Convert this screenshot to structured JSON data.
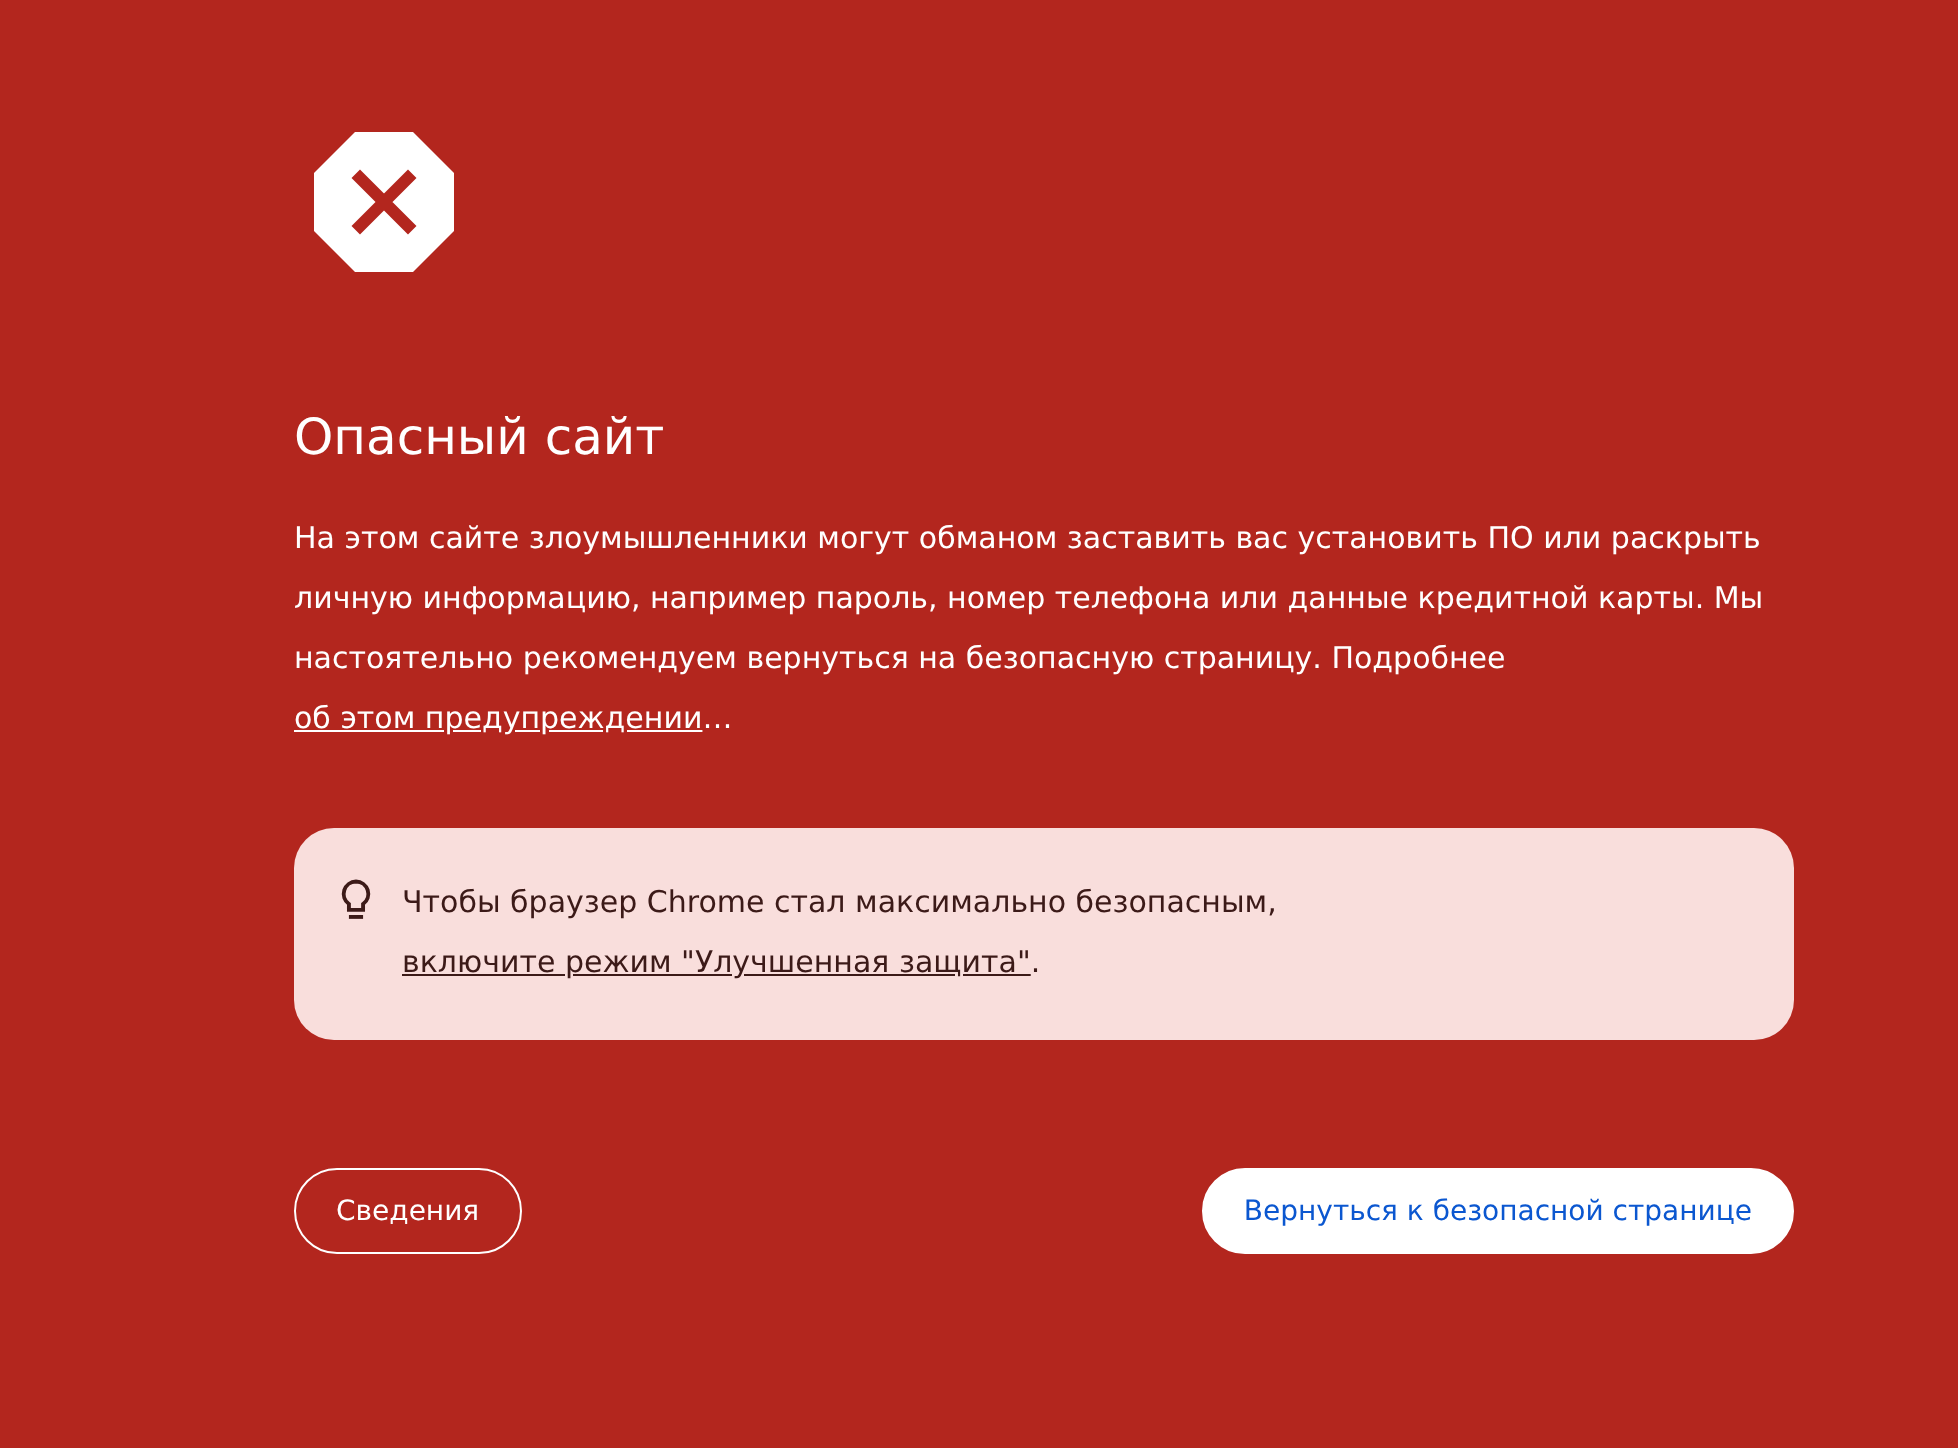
{
  "title": "Опасный сайт",
  "message": {
    "text": "На этом сайте злоумышленники могут обманом заставить вас установить ПО или раскрыть личную информацию, например пароль, номер телефона или данные кредитной карты. Мы настоятельно рекомендуем вернуться на безопасную страницу. Подробнее ",
    "link": "об этом предупреждении",
    "after": "…"
  },
  "tip": {
    "text": "Чтобы браузер Chrome стал максимально безопасным, ",
    "link": "включите режим \"Улучшенная защита\"",
    "after": "."
  },
  "buttons": [
    {
      "kind": "outline",
      "label": "Сведения"
    },
    {
      "kind": "primary",
      "label": "Вернуться к безопасной странице"
    }
  ]
}
